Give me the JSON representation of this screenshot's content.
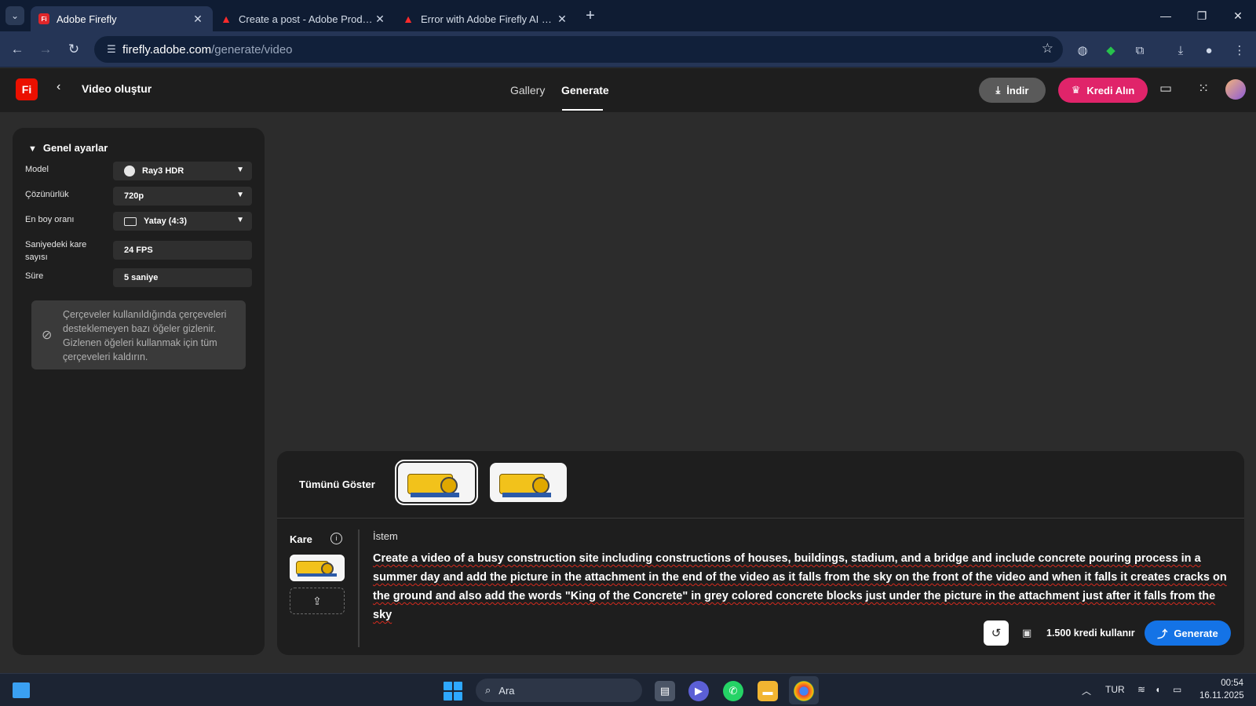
{
  "browser": {
    "tabs": [
      {
        "title": "Adobe Firefly",
        "favicon": "firefly-icon",
        "active": true
      },
      {
        "title": "Create a post - Adobe Product Community",
        "favicon": "adobe-icon",
        "active": false
      },
      {
        "title": "Error with Adobe Firefly AI Video",
        "favicon": "adobe-icon",
        "active": false
      }
    ],
    "url_host": "firefly.adobe.com",
    "url_path": "/generate/video"
  },
  "app": {
    "logo_text": "Fi",
    "page_title": "Video oluştur",
    "nav": {
      "gallery": "Gallery",
      "generate": "Generate"
    },
    "download_label": "İndir",
    "credits_label": "Kredi Alın"
  },
  "settings": {
    "section_title": "Genel ayarlar",
    "model_label": "Model",
    "model_value": "Ray3 HDR",
    "resolution_label": "Çözünürlük",
    "resolution_value": "720p",
    "aspect_label": "En boy oranı",
    "aspect_value": "Yatay (4:3)",
    "fps_label": "Saniyedeki kare sayısı",
    "fps_value": "24 FPS",
    "duration_label": "Süre",
    "duration_value": "5 saniye",
    "notice": "Çerçeveler kullanıldığında çerçeveleri desteklemeyen bazı öğeler gizlenir. Gizlenen öğeleri kullanmak için tüm çerçeveleri kaldırın."
  },
  "panel": {
    "show_all": "Tümünü Göster",
    "frame_label": "Kare",
    "prompt_label": "İstem",
    "prompt": "Create a video of a busy construction site including constructions of houses, buildings, stadium, and a bridge and include concrete pouring process in a summer day and add the picture in the attachment in the end of the video as it falls from the sky on the front of the video and when it falls it creates cracks on the ground and also add the words \"King of the Concrete\" in grey colored concrete blocks just under the picture in the attachment just after it falls from the sky",
    "credit_cost": "1.500 kredi kullanır",
    "generate_label": "Generate"
  },
  "taskbar": {
    "search_placeholder": "Ara",
    "lang": "TUR",
    "time": "00:54",
    "date": "16.11.2025"
  },
  "colors": {
    "accent_blue": "#1473e6",
    "credit_pink": "#e0246a",
    "firefly_red": "#eb1000"
  }
}
